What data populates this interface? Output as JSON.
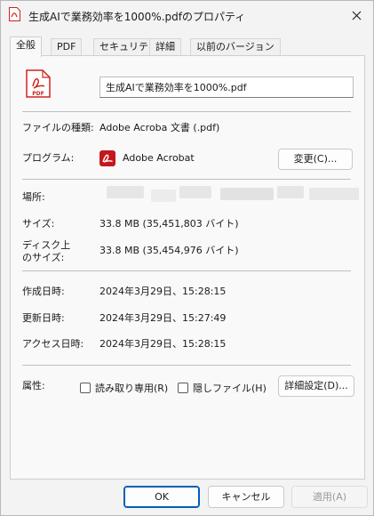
{
  "window": {
    "title": "生成AIで業務効率を1000%.pdfのプロパティ"
  },
  "tabs": [
    {
      "label": "全般"
    },
    {
      "label": "PDF"
    },
    {
      "label": "セキュリティ"
    },
    {
      "label": "詳細"
    },
    {
      "label": "以前のバージョン"
    }
  ],
  "general": {
    "file_name": "生成AIで業務効率を1000%.pdf",
    "file_type_label": "ファイルの種類:",
    "file_type_value": "Adobe Acroba 文書 (.pdf)",
    "program_label": "プログラム:",
    "program_value": "Adobe Acrobat",
    "change_button": "変更(C)...",
    "location_label": "場所:",
    "size_label": "サイズ:",
    "size_value": "33.8 MB (35,451,803 バイト)",
    "disk_size_label_1": "ディスク上",
    "disk_size_label_2": "のサイズ:",
    "disk_size_value": "33.8 MB (35,454,976 バイト)",
    "created_label": "作成日時:",
    "created_value": "2024年3月29日、15:28:15",
    "modified_label": "更新日時:",
    "modified_value": "2024年3月29日、15:27:49",
    "accessed_label": "アクセス日時:",
    "accessed_value": "2024年3月29日、15:28:15",
    "attributes_label": "属性:",
    "readonly_label": "読み取り専用(R)",
    "hidden_label": "隠しファイル(H)",
    "advanced_button": "詳細設定(D)..."
  },
  "footer": {
    "ok": "OK",
    "cancel": "キャンセル",
    "apply": "適用(A)"
  },
  "colors": {
    "pdf_red": "#d1241c",
    "accent": "#005fb8"
  }
}
